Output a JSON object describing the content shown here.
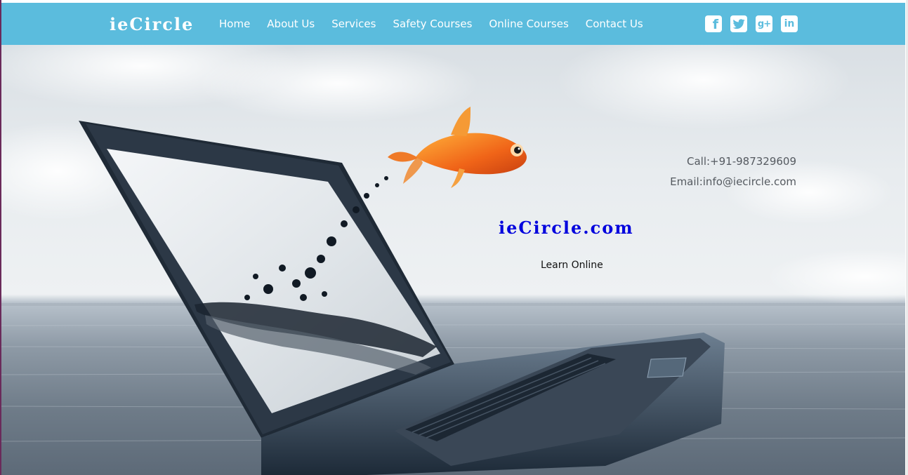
{
  "header": {
    "brand": "ieCircle",
    "nav": [
      "Home",
      "About Us",
      "Services",
      "Safety Courses",
      "Online Courses",
      "Contact Us"
    ],
    "social": [
      {
        "icon": "facebook-icon",
        "glyph": "f"
      },
      {
        "icon": "twitter-icon",
        "glyph": "t"
      },
      {
        "icon": "google-plus-icon",
        "glyph": "g+"
      },
      {
        "icon": "linkedin-icon",
        "glyph": "in"
      }
    ]
  },
  "hero": {
    "call": "Call:+91-987329609",
    "email": "Email:info@iecircle.com",
    "title": "ieCircle.com",
    "subtitle": "Learn Online"
  },
  "colors": {
    "navbar": "#5bbcdd",
    "title": "#0000dd",
    "text": "#555a60"
  }
}
